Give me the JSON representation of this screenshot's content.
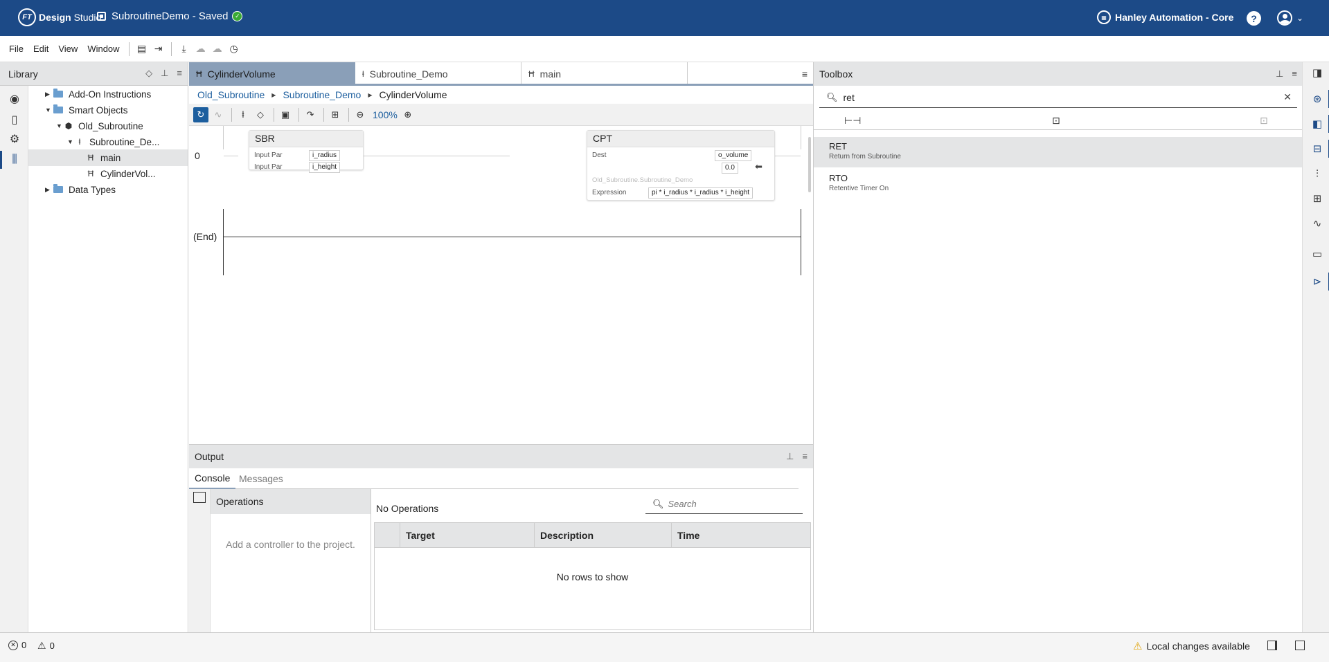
{
  "header": {
    "logo_ft": "FT",
    "logo_bold": "Design",
    "logo_rest": "Studio",
    "project_name": "SubroutineDemo",
    "project_status": "- Saved",
    "org_name": "Hanley Automation - Core",
    "help_label": "?",
    "accent": "#1c4a87"
  },
  "menu": {
    "items": [
      "File",
      "Edit",
      "View",
      "Window"
    ]
  },
  "library": {
    "title": "Library",
    "nodes": [
      {
        "label": "Add-On Instructions",
        "icon": "folder-icon"
      },
      {
        "label": "Smart Objects",
        "icon": "folder-icon"
      },
      {
        "label": "Old_Subroutine",
        "icon": "hexagon-icon"
      },
      {
        "label": "Subroutine_De...",
        "icon": "subroutine-icon"
      },
      {
        "label": "main",
        "icon": "ladder-icon"
      },
      {
        "label": "CylinderVol...",
        "icon": "ladder-icon"
      },
      {
        "label": "Data Types",
        "icon": "folder-icon"
      }
    ]
  },
  "tabs": [
    {
      "label": "CylinderVolume",
      "icon": "ladder-icon",
      "active": true
    },
    {
      "label": "Subroutine_Demo",
      "icon": "subroutine-icon",
      "active": false
    },
    {
      "label": "main",
      "icon": "ladder-icon",
      "active": false
    }
  ],
  "breadcrumb": {
    "items": [
      "Old_Subroutine",
      "Subroutine_Demo"
    ],
    "current": "CylinderVolume"
  },
  "editor_toolbar": {
    "zoom": "100%"
  },
  "ladder": {
    "rung_number": "0",
    "end_label": "(End)",
    "sbr": {
      "name": "SBR",
      "rows": [
        {
          "label": "Input Par",
          "value": "i_radius"
        },
        {
          "label": "Input Par",
          "value": "i_height"
        }
      ]
    },
    "cpt": {
      "name": "CPT",
      "dest_label": "Dest",
      "dest_value": "o_volume",
      "dest_number": "0.0",
      "scope_hint": "Old_Subroutine.Subroutine_Demo",
      "expr_label": "Expression",
      "expr_value": "pi * i_radius * i_radius * i_height"
    }
  },
  "output": {
    "title": "Output",
    "tabs": [
      "Console",
      "Messages"
    ],
    "operations_title": "Operations",
    "operations_empty": "Add a controller to the project.",
    "no_operations": "No Operations",
    "search_placeholder": "Search",
    "columns": [
      "Target",
      "Description",
      "Time"
    ],
    "no_rows": "No rows to show"
  },
  "toolbox": {
    "title": "Toolbox",
    "search_value": "ret",
    "items": [
      {
        "name": "RET",
        "desc": "Return from Subroutine"
      },
      {
        "name": "RTO",
        "desc": "Retentive Timer On"
      }
    ]
  },
  "status": {
    "errors": "0",
    "warnings": "0",
    "local_changes": "Local changes available"
  }
}
